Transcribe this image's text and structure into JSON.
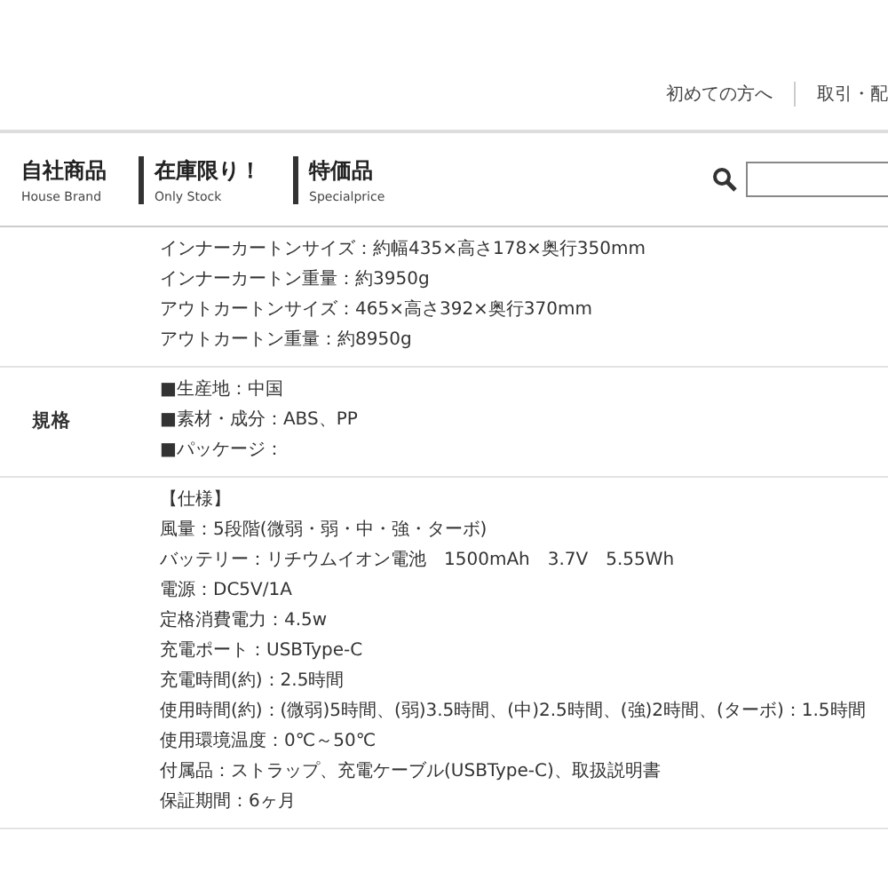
{
  "top_links": [
    "初めての方へ",
    "取引・配"
  ],
  "nav": [
    {
      "label": "自社商品",
      "sub": "House Brand"
    },
    {
      "label": "在庫限り！",
      "sub": "Only Stock"
    },
    {
      "label": "特価品",
      "sub": "Specialprice"
    }
  ],
  "rows": [
    {
      "lines": [
        "インナーカートンサイズ：約幅435×高さ178×奥行350mm",
        "インナーカートン重量：約3950g",
        "アウトカートンサイズ：465×高さ392×奥行370mm",
        "アウトカートン重量：約8950g"
      ]
    },
    {
      "label": "規格",
      "lines": [
        "■生産地：中国",
        "■素材・成分：ABS、PP",
        "■パッケージ："
      ]
    },
    {
      "lines": [
        "【仕様】",
        "風量：5段階(微弱・弱・中・強・ターボ)",
        "バッテリー：リチウムイオン電池　1500mAh　3.7V　5.55Wh",
        "電源：DC5V/1A",
        "定格消費電力：4.5w",
        "充電ポート：USBType-C",
        "充電時間(約)：2.5時間",
        "使用時間(約)：(微弱)5時間、(弱)3.5時間、(中)2.5時間、(強)2時間、(ターボ)：1.5時間",
        "使用環境温度：0℃～50℃",
        "付属品：ストラップ、充電ケーブル(USBType-C)、取扱説明書",
        "保証期間：6ヶ月"
      ]
    }
  ]
}
